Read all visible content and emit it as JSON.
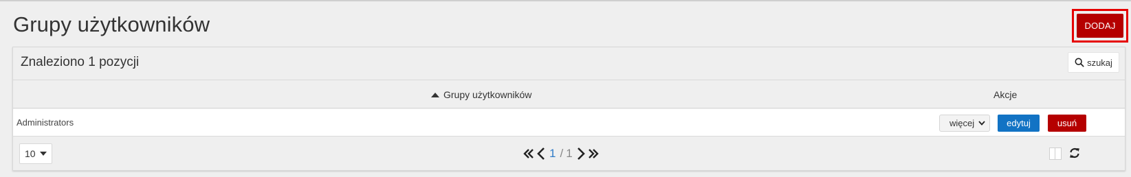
{
  "header": {
    "title": "Grupy użytkowników",
    "add_label": "DODAJ"
  },
  "list": {
    "found_text": "Znaleziono 1 pozycji",
    "search_label": "szukaj",
    "columns": {
      "name": "Grupy użytkowników",
      "actions": "Akcje"
    },
    "rows": [
      {
        "name": "Administrators",
        "more_label": "więcej",
        "edit_label": "edytuj",
        "delete_label": "usuń"
      }
    ]
  },
  "pagination": {
    "page_size": "10",
    "current_page": "1",
    "separator": "/",
    "total_pages": "1"
  },
  "colors": {
    "primary_red": "#b50000",
    "highlight_red": "#e60000",
    "edit_blue": "#1273c4",
    "page_number_blue": "#2f7bc7"
  },
  "icons": {
    "sort": "sort-asc-icon",
    "search": "search-icon",
    "select": "chevron-down-icon",
    "first": "double-chevron-left-icon",
    "prev": "chevron-left-icon",
    "next": "chevron-right-icon",
    "last": "double-chevron-right-icon",
    "columns": "columns-icon",
    "refresh": "refresh-icon"
  }
}
